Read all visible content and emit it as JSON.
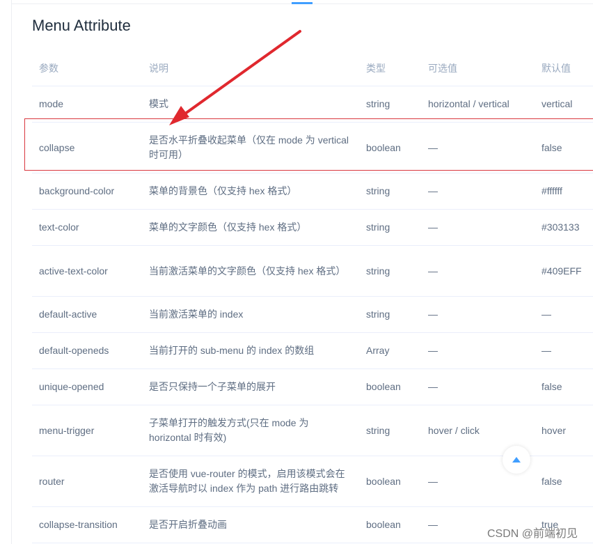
{
  "title": "Menu Attribute",
  "table": {
    "headers": [
      "参数",
      "说明",
      "类型",
      "可选值",
      "默认值"
    ],
    "rows": [
      {
        "param": "mode",
        "desc": "模式",
        "type": "string",
        "options": "horizontal / vertical",
        "default": "vertical"
      },
      {
        "param": "collapse",
        "desc": "是否水平折叠收起菜单（仅在 mode 为 vertical 时可用）",
        "type": "boolean",
        "options": "—",
        "default": "false"
      },
      {
        "param": "background-color",
        "desc": "菜单的背景色（仅支持 hex 格式）",
        "type": "string",
        "options": "—",
        "default": "#ffffff"
      },
      {
        "param": "text-color",
        "desc": "菜单的文字颜色（仅支持 hex 格式）",
        "type": "string",
        "options": "—",
        "default": "#303133"
      },
      {
        "param": "active-text-color",
        "desc": "当前激活菜单的文字颜色（仅支持 hex 格式）",
        "type": "string",
        "options": "—",
        "default": "#409EFF"
      },
      {
        "param": "default-active",
        "desc": "当前激活菜单的 index",
        "type": "string",
        "options": "—",
        "default": "—"
      },
      {
        "param": "default-openeds",
        "desc": "当前打开的 sub-menu 的 index 的数组",
        "type": "Array",
        "options": "—",
        "default": "—"
      },
      {
        "param": "unique-opened",
        "desc": "是否只保持一个子菜单的展开",
        "type": "boolean",
        "options": "—",
        "default": "false"
      },
      {
        "param": "menu-trigger",
        "desc": "子菜单打开的触发方式(只在 mode 为 horizontal 时有效)",
        "type": "string",
        "options": "hover / click",
        "default": "hover"
      },
      {
        "param": "router",
        "desc": "是否使用 vue-router 的模式，启用该模式会在激活导航时以 index 作为 path 进行路由跳转",
        "type": "boolean",
        "options": "—",
        "default": "false"
      },
      {
        "param": "collapse-transition",
        "desc": "是否开启折叠动画",
        "type": "boolean",
        "options": "—",
        "default": "true"
      }
    ]
  },
  "annotation": {
    "highlight_color": "#d9363e",
    "arrow_color": "#e0282e"
  },
  "scroll_top_icon": "caret-up-icon",
  "accent_color": "#409eff",
  "watermark": "CSDN @前端初见"
}
